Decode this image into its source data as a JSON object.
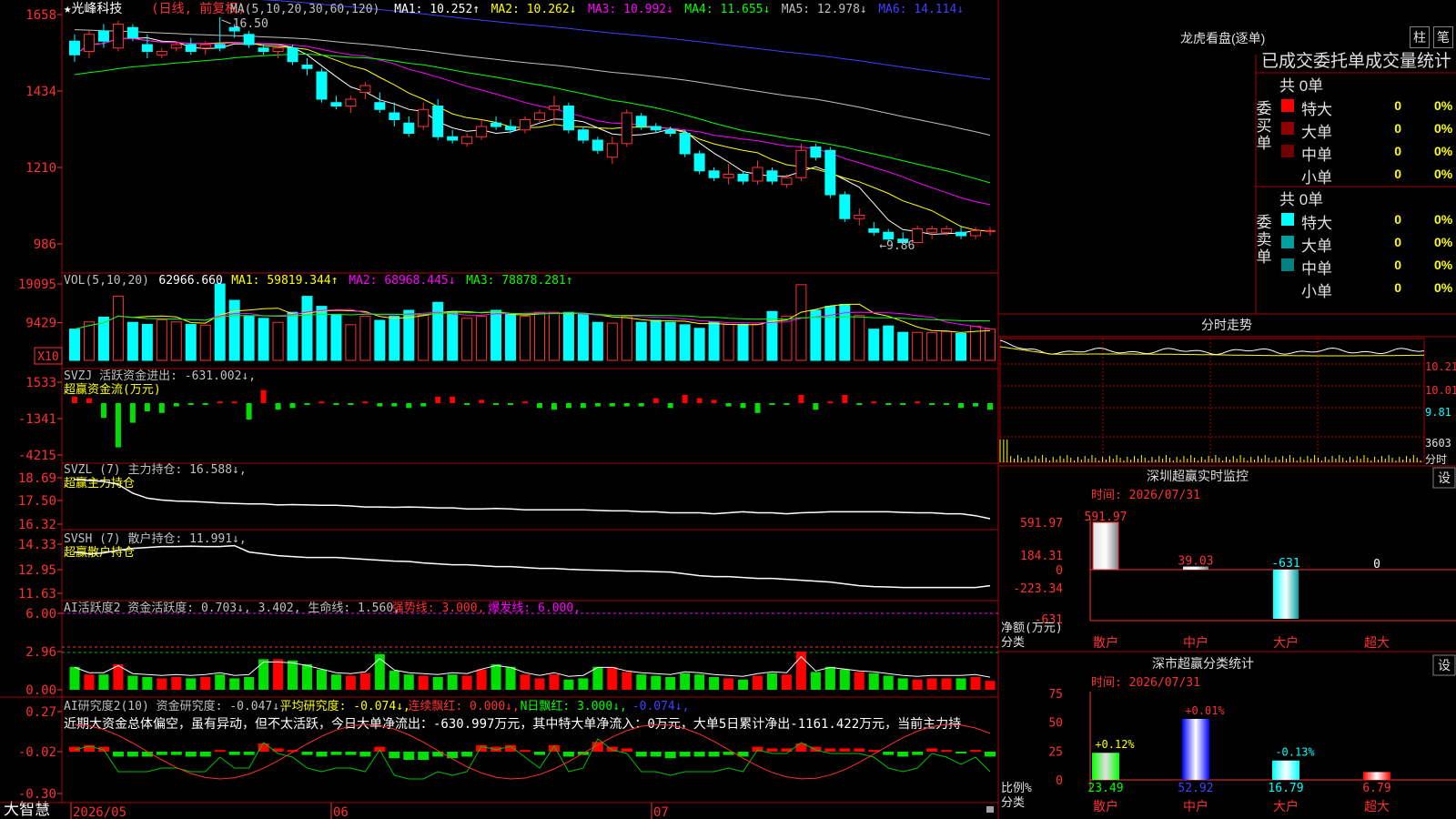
{
  "stock": {
    "star": "★",
    "name": "光峰科技",
    "period": "(日线, 前复权)"
  },
  "ma_legend": [
    {
      "text": "MA(5,10,20,30,60,120)",
      "color": "#c0c0c0"
    },
    {
      "text": "MA1: 10.252↑",
      "color": "#ffffff"
    },
    {
      "text": "MA2: 10.262↓",
      "color": "#ffff00"
    },
    {
      "text": "MA3: 10.992↓",
      "color": "#ff00ff"
    },
    {
      "text": "MA4: 11.655↓",
      "color": "#00ff00"
    },
    {
      "text": "MA5: 12.978↓",
      "color": "#c0c0c0"
    },
    {
      "text": "MA6: 14.114↓",
      "color": "#4040ff"
    }
  ],
  "price_axis": [
    "1658",
    "1434",
    "1210",
    "986"
  ],
  "high_label": "16.50",
  "low_label": "←9.86",
  "vol_legend": [
    {
      "text": "VOL(5,10,20)",
      "color": "#c0c0c0"
    },
    {
      "text": "62966.660",
      "color": "#ffffff"
    },
    {
      "text": "MA1: 59819.344↑",
      "color": "#ffff00"
    },
    {
      "text": "MA2: 68968.445↓",
      "color": "#ff00ff"
    },
    {
      "text": "MA3: 78878.281↑",
      "color": "#00ff00"
    }
  ],
  "vol_axis": [
    "19095",
    "9429"
  ],
  "vol_unit": "X10",
  "svzj": {
    "legend": "SVZJ  活跃资金进出: -631.002↓,",
    "sub": "超赢资金流(万元)",
    "axis": [
      "1533",
      "-1341",
      "-4215"
    ]
  },
  "svzl": {
    "legend": "SVZL (7) 主力持仓: 16.588↓,",
    "sub": "超赢主力持仓",
    "axis": [
      "18.69",
      "17.50",
      "16.32"
    ]
  },
  "svsh": {
    "legend": "SVSH (7) 散户持仓: 11.991↓,",
    "sub": "超赢散户持仓",
    "axis": [
      "14.33",
      "12.95",
      "11.63"
    ]
  },
  "ai1": {
    "legend": [
      {
        "text": "AI活跃度2 资金活跃度: 0.703↓, 3.402, 生命线: 1.560, ",
        "color": "#c0c0c0"
      },
      {
        "text": "强势线: 3.000, ",
        "color": "#ff3030"
      },
      {
        "text": "爆发线: 6.000,",
        "color": "#ff00ff"
      }
    ],
    "axis": [
      "6.00",
      "2.96",
      "0.00"
    ]
  },
  "ai2": {
    "legend": [
      {
        "text": "AI研究度2(10) 资金研究度: -0.047↓, ",
        "color": "#c0c0c0"
      },
      {
        "text": "平均研究度: -0.074↓, ",
        "color": "#ffff00"
      },
      {
        "text": "连续飘红: 0.000↓, ",
        "color": "#ff3030"
      },
      {
        "text": "N日飘红: 3.000↓, ",
        "color": "#00ff00"
      },
      {
        "text": "-0.074↓,",
        "color": "#4040ff"
      }
    ],
    "commentary": "近期大资金总体偏空，虽有异动，但不太活跃，今日大单净流出：-630.997万元，其中特大单净流入：0万元，大单5日累计净出-1161.422万元，当前主力持",
    "axis": [
      "0.27",
      "-0.02",
      "-0.30"
    ]
  },
  "date_axis": [
    "2026/05",
    "06",
    "07"
  ],
  "app_name": "大智慧",
  "lhb": {
    "title": "龙虎看盘(逐单)",
    "btn1": "柱",
    "btn2": "笔",
    "header": "已成交委托单成交量统计",
    "buy": {
      "label": "委买单",
      "total": "共 0单",
      "rows": [
        {
          "name": "特大",
          "count": "0",
          "pct": "0%",
          "color": "#ff0000"
        },
        {
          "name": "大单",
          "count": "0",
          "pct": "0%",
          "color": "#900000"
        },
        {
          "name": "中单",
          "count": "0",
          "pct": "0%",
          "color": "#700000"
        },
        {
          "name": "小单",
          "count": "0",
          "pct": "0%",
          "color": "#000000"
        }
      ]
    },
    "sell": {
      "label": "委卖单",
      "total": "共 0单",
      "rows": [
        {
          "name": "特大",
          "count": "0",
          "pct": "0%",
          "color": "#00ffff"
        },
        {
          "name": "大单",
          "count": "0",
          "pct": "0%",
          "color": "#00a0a0"
        },
        {
          "name": "中单",
          "count": "0",
          "pct": "0%",
          "color": "#008080"
        },
        {
          "name": "小单",
          "count": "0",
          "pct": "0%",
          "color": "#000000"
        }
      ]
    }
  },
  "fenshi": {
    "title": "分时走势",
    "axis": [
      "10.21",
      "10.01",
      "9.81",
      "3603",
      "分时"
    ]
  },
  "sz_monitor": {
    "title": "深圳超赢实时监控",
    "btn": "设",
    "time": "时间: 2026/07/31",
    "axis": [
      "591.97",
      "184.31",
      "0",
      "-223.34",
      "-631"
    ],
    "unit_label": "净额(万元)",
    "cat_label": "分类",
    "bars": [
      {
        "name": "散户",
        "value": 591.97,
        "label": "591.97"
      },
      {
        "name": "中户",
        "value": 39.03,
        "label": "39.03"
      },
      {
        "name": "大户",
        "value": -631,
        "label": "-631"
      },
      {
        "name": "超大",
        "value": 0,
        "label": "0"
      }
    ]
  },
  "sz_class": {
    "title": "深市超赢分类统计",
    "btn": "设",
    "time": "时间: 2026/07/31",
    "axis": [
      "75",
      "50",
      "25",
      "0"
    ],
    "unit_label": "比例%",
    "cat_label": "分类",
    "bars": [
      {
        "name": "散户",
        "value": 23.49,
        "label": "23.49",
        "change": "+0.12%"
      },
      {
        "name": "中户",
        "value": 52.92,
        "label": "52.92",
        "change": "+0.01%"
      },
      {
        "name": "大户",
        "value": 16.79,
        "label": "16.79",
        "change": "-0.13%"
      },
      {
        "name": "超大",
        "value": 6.79,
        "label": "6.79",
        "change": ""
      }
    ]
  },
  "chart_data": {
    "type": "candlestick",
    "dates_start": "2026/05",
    "ohlc": [
      [
        15.8,
        16.0,
        15.2,
        15.4
      ],
      [
        15.5,
        16.1,
        15.3,
        16.0
      ],
      [
        16.1,
        16.3,
        15.6,
        15.8
      ],
      [
        15.6,
        16.4,
        15.5,
        16.3
      ],
      [
        16.2,
        16.3,
        15.8,
        15.9
      ],
      [
        15.7,
        16.0,
        15.3,
        15.5
      ],
      [
        15.4,
        15.6,
        15.3,
        15.5
      ],
      [
        15.6,
        15.8,
        15.5,
        15.7
      ],
      [
        15.7,
        15.9,
        15.4,
        15.5
      ],
      [
        15.6,
        15.8,
        15.4,
        15.7
      ],
      [
        15.7,
        16.5,
        15.5,
        15.6
      ],
      [
        16.2,
        16.3,
        15.9,
        16.1
      ],
      [
        16.0,
        16.1,
        15.6,
        15.7
      ],
      [
        15.6,
        15.7,
        15.4,
        15.5
      ],
      [
        15.5,
        15.7,
        15.3,
        15.6
      ],
      [
        15.6,
        15.7,
        15.1,
        15.2
      ],
      [
        15.1,
        15.3,
        14.8,
        15.0
      ],
      [
        14.9,
        15.0,
        14.0,
        14.1
      ],
      [
        14.0,
        14.2,
        13.8,
        13.9
      ],
      [
        13.9,
        14.2,
        13.7,
        14.1
      ],
      [
        14.3,
        14.6,
        14.1,
        14.5
      ],
      [
        14.0,
        14.3,
        13.7,
        13.8
      ],
      [
        13.7,
        14.0,
        13.3,
        13.5
      ],
      [
        13.4,
        13.6,
        13.0,
        13.1
      ],
      [
        13.3,
        14.0,
        13.2,
        13.8
      ],
      [
        13.9,
        14.1,
        12.9,
        13.0
      ],
      [
        13.0,
        13.2,
        12.8,
        12.9
      ],
      [
        12.8,
        13.1,
        12.7,
        13.0
      ],
      [
        13.0,
        13.5,
        12.9,
        13.3
      ],
      [
        13.4,
        13.6,
        13.2,
        13.3
      ],
      [
        13.3,
        13.5,
        13.1,
        13.2
      ],
      [
        13.2,
        13.6,
        13.1,
        13.5
      ],
      [
        13.5,
        13.8,
        13.4,
        13.7
      ],
      [
        13.8,
        14.2,
        13.4,
        13.9
      ],
      [
        13.9,
        14.0,
        13.1,
        13.2
      ],
      [
        13.2,
        13.3,
        12.8,
        12.9
      ],
      [
        12.9,
        13.0,
        12.5,
        12.6
      ],
      [
        12.4,
        13.0,
        12.2,
        12.8
      ],
      [
        12.8,
        13.8,
        12.7,
        13.7
      ],
      [
        13.6,
        13.7,
        13.2,
        13.3
      ],
      [
        13.3,
        13.4,
        13.1,
        13.2
      ],
      [
        13.2,
        13.3,
        13.0,
        13.1
      ],
      [
        13.1,
        13.2,
        12.4,
        12.5
      ],
      [
        12.5,
        12.6,
        11.9,
        12.0
      ],
      [
        12.0,
        12.1,
        11.7,
        11.8
      ],
      [
        11.8,
        12.2,
        11.6,
        11.9
      ],
      [
        11.9,
        12.0,
        11.6,
        11.7
      ],
      [
        11.7,
        12.3,
        11.6,
        12.1
      ],
      [
        12.0,
        12.1,
        11.6,
        11.7
      ],
      [
        11.6,
        11.9,
        11.5,
        11.8
      ],
      [
        11.8,
        12.8,
        11.7,
        12.6
      ],
      [
        12.7,
        12.8,
        12.3,
        12.4
      ],
      [
        12.6,
        12.7,
        11.2,
        11.3
      ],
      [
        11.3,
        11.4,
        10.5,
        10.6
      ],
      [
        10.6,
        10.9,
        10.4,
        10.7
      ],
      [
        10.3,
        10.5,
        10.1,
        10.2
      ],
      [
        10.2,
        10.3,
        9.9,
        10.0
      ],
      [
        10.0,
        10.2,
        9.86,
        9.9
      ],
      [
        9.9,
        10.4,
        9.88,
        10.3
      ],
      [
        10.2,
        10.4,
        10.0,
        10.3
      ],
      [
        10.2,
        10.4,
        10.1,
        10.3
      ],
      [
        10.2,
        10.4,
        10.0,
        10.1
      ],
      [
        10.1,
        10.35,
        10.0,
        10.25
      ],
      [
        10.25,
        10.35,
        10.1,
        10.25
      ]
    ],
    "volume": [
      7800,
      9600,
      10800,
      16000,
      9500,
      9000,
      10100,
      9600,
      9000,
      8800,
      19095,
      15000,
      11000,
      10500,
      9500,
      12000,
      16000,
      13500,
      11500,
      8900,
      11000,
      10000,
      11000,
      12500,
      11300,
      14500,
      12000,
      10500,
      11000,
      12500,
      11500,
      11000,
      12000,
      12000,
      12000,
      11500,
      9500,
      9300,
      11000,
      9500,
      10000,
      9500,
      8900,
      8000,
      9600,
      9000,
      9000,
      9000,
      12200,
      11000,
      18900,
      12500,
      13500,
      14000,
      11200,
      7800,
      8600,
      7000,
      7000,
      6900,
      7200,
      6700,
      8500,
      7800
    ],
    "ylim_price": [
      9.86,
      16.58
    ],
    "y_axis_ticks_shown": [
      "1658",
      "1434",
      "1210",
      "986"
    ]
  }
}
